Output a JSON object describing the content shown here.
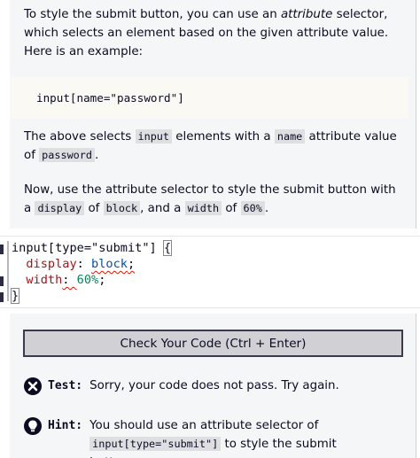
{
  "instructions": {
    "p1_before": "To style the submit button, you can use an ",
    "p1_em": "attribute",
    "p1_after": " selector, which selects an element based on the given attribute value. Here is an example:",
    "example_code": "input[name=\"password\"]",
    "p2_a": "The above selects ",
    "p2_code1": "input",
    "p2_b": " elements with a ",
    "p2_code2": "name",
    "p2_c": " attribute value of ",
    "p2_code3": "password",
    "p2_d": ".",
    "p3_a": "Now, use the attribute selector to style the submit button with a ",
    "p3_code1": "display",
    "p3_b": " of ",
    "p3_code2": "block",
    "p3_c": ", and a ",
    "p3_code3": "width",
    "p3_d": " of ",
    "p3_code4": "60%",
    "p3_e": "."
  },
  "editor": {
    "line1_selector": "input[type=\"submit\"] ",
    "line1_brace": "{",
    "line2_indent": "  ",
    "line2_prop": "display",
    "line2_colon": ": ",
    "line2_val": "block",
    "line2_semi": ";",
    "line3_indent": "  ",
    "line3_prop": "width",
    "line3_colon": ": ",
    "line3_val": "60%",
    "line3_semi": ";",
    "line4_brace": "}"
  },
  "results": {
    "check_button_label": "Check Your Code (Ctrl + Enter)",
    "test_label": "Test:",
    "test_text": "Sorry, your code does not pass. Try again.",
    "hint_label": "Hint:",
    "hint_a": "You should use an attribute selector of ",
    "hint_code": "input[type=\"submit\"]",
    "hint_b": " to style the submit button."
  },
  "colors": {
    "panel_bg": "#f5f6f7",
    "inline_code_bg": "#dfdfe2",
    "property": "#a31515",
    "value": "#0451a5",
    "number": "#098658",
    "error_squiggle": "#e51400"
  },
  "icons": {
    "test": "x-circle-icon",
    "hint": "lightbulb-icon"
  }
}
